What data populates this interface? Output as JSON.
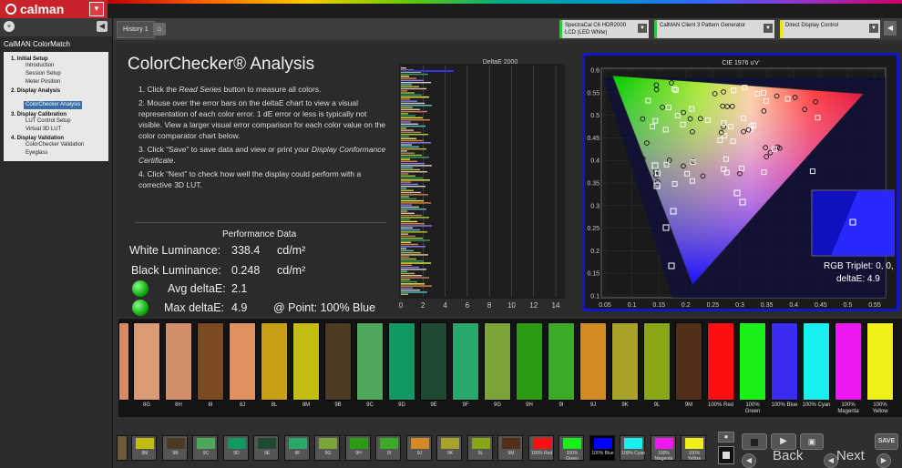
{
  "app": {
    "logo": "calman"
  },
  "sidebar": {
    "title": "CalMAN ColorMatch",
    "sections": [
      {
        "label": "1. Initial Setup",
        "items": [
          "Introduction",
          "Session Setup",
          "Meter Position"
        ]
      },
      {
        "label": "2. Display Analysis",
        "items": [
          "ColorChecker Analysis"
        ]
      },
      {
        "label": "3. Display Calibration",
        "items": [
          "LUT Control Setup",
          "Virtual 3D LUT"
        ]
      },
      {
        "label": "4. Display Validation",
        "items": [
          "ColorChecker Validation",
          "Eyeglass"
        ]
      }
    ],
    "selected": "ColorChecker Analysis"
  },
  "header": {
    "tab": "History 1",
    "devices": [
      {
        "line1": "SpectraCal C6 HDR2000",
        "line2": "LCD (LED White)",
        "color": "#2ecc2e"
      },
      {
        "line1": "CalMAN Client 3 Pattern Generator",
        "line2": "",
        "color": "#2ecc2e"
      },
      {
        "line1": "Direct Display Control",
        "line2": "",
        "color": "#f0e020"
      }
    ]
  },
  "main": {
    "title": "ColorChecker® Analysis",
    "steps": [
      {
        "pre": "1.  Click the ",
        "em": "Read Series",
        "post": " button to measure all colors."
      },
      {
        "pre": "2.  Mouse over the error bars on the deltaE chart to view a visual representation of each color error. 1 dE error or less is typically not visible. View a larger visual error comparison for each color value on the color comparator chart below.",
        "em": "",
        "post": ""
      },
      {
        "pre": "3.  Click “Save” to save data and view or print your ",
        "em": "Display Conformance Certificate",
        "post": "."
      },
      {
        "pre": "4.  Click “Next” to check how well the display could perform with a corrective 3D LUT.",
        "em": "",
        "post": ""
      }
    ],
    "perf": {
      "title": "Performance Data",
      "white_label": "White Luminance:",
      "white_value": "338.4",
      "white_unit": "cd/m²",
      "black_label": "Black Luminance:",
      "black_value": "0.248",
      "black_unit": "cd/m²",
      "avg_label": "Avg deltaE:",
      "avg_value": "2.1",
      "max_label": "Max deltaE:",
      "max_value": "4.9",
      "point_label": "@ Point: 100% Blue"
    }
  },
  "deltae_chart": {
    "title": "DeltaE 2000",
    "xticks": [
      "0",
      "2",
      "4",
      "6",
      "8",
      "10",
      "12",
      "14"
    ],
    "xlim": [
      0,
      15
    ]
  },
  "cie_chart": {
    "title": "CIE 1976 u'v'",
    "yticks": [
      "0.6",
      "0.55",
      "0.5",
      "0.45",
      "0.4",
      "0.35",
      "0.3",
      "0.25",
      "0.2",
      "0.15",
      "0.1"
    ],
    "xticks": [
      "0.05",
      "0.1",
      "0.15",
      "0.2",
      "0.25",
      "0.3",
      "0.35",
      "0.4",
      "0.45",
      "0.5",
      "0.55"
    ],
    "rgb_triplet": "RGB Triplet: 0, 0, 255",
    "deltae": "deltaE: 4.9"
  },
  "patches": [
    {
      "label": "8G",
      "color": "#d99a74"
    },
    {
      "label": "8H",
      "color": "#d08e6a"
    },
    {
      "label": "8I",
      "color": "#7a4a22"
    },
    {
      "label": "8J",
      "color": "#e0925e"
    },
    {
      "label": "8L",
      "color": "#c9a014"
    },
    {
      "label": "8M",
      "color": "#c4bd10"
    },
    {
      "label": "9B",
      "color": "#4b3b22"
    },
    {
      "label": "9C",
      "color": "#4ea85a"
    },
    {
      "label": "9D",
      "color": "#129862"
    },
    {
      "label": "9E",
      "color": "#1e4a34"
    },
    {
      "label": "9F",
      "color": "#29a86c"
    },
    {
      "label": "9G",
      "color": "#7ca43a"
    },
    {
      "label": "9H",
      "color": "#2c9a14"
    },
    {
      "label": "9I",
      "color": "#3aaa28"
    },
    {
      "label": "9J",
      "color": "#d48a22"
    },
    {
      "label": "9K",
      "color": "#a8a22a"
    },
    {
      "label": "9L",
      "color": "#8aa616"
    },
    {
      "label": "9M",
      "color": "#532e1a"
    },
    {
      "label": "100% Red",
      "color": "#ff1010"
    },
    {
      "label": "100% Green",
      "color": "#18f018"
    },
    {
      "label": "100% Blue",
      "color": "#3a2cf0"
    },
    {
      "label": "100% Cyan",
      "color": "#18f0f0"
    },
    {
      "label": "100% Magenta",
      "color": "#f018f0"
    },
    {
      "label": "100% Yellow",
      "color": "#f0f018"
    }
  ],
  "bottom_patches": [
    {
      "label": "8M",
      "color": "#c4bd10"
    },
    {
      "label": "9B",
      "color": "#4b3b22"
    },
    {
      "label": "9C",
      "color": "#4ea85a"
    },
    {
      "label": "9D",
      "color": "#129862"
    },
    {
      "label": "9E",
      "color": "#1e4a34"
    },
    {
      "label": "9F",
      "color": "#29a86c"
    },
    {
      "label": "9G",
      "color": "#7ca43a"
    },
    {
      "label": "9H",
      "color": "#2c9a14"
    },
    {
      "label": "9I",
      "color": "#3aaa28"
    },
    {
      "label": "9J",
      "color": "#d48a22"
    },
    {
      "label": "9K",
      "color": "#a8a22a"
    },
    {
      "label": "9L",
      "color": "#8aa616"
    },
    {
      "label": "9M",
      "color": "#532e1a"
    },
    {
      "label": "100% Red",
      "color": "#ff1010"
    },
    {
      "label": "100% Green",
      "color": "#18f018"
    },
    {
      "label": "100% Blue",
      "color": "#0000ff"
    },
    {
      "label": "100% Cyan",
      "color": "#18f0f0"
    },
    {
      "label": "100% Magenta",
      "color": "#f018f0"
    },
    {
      "label": "100% Yellow",
      "color": "#f0f018"
    }
  ],
  "controls": {
    "back": "Back",
    "next": "Next",
    "save": "SAVE"
  },
  "colors": {
    "accent": "#c8232b",
    "cie_border": "#1414c8"
  }
}
